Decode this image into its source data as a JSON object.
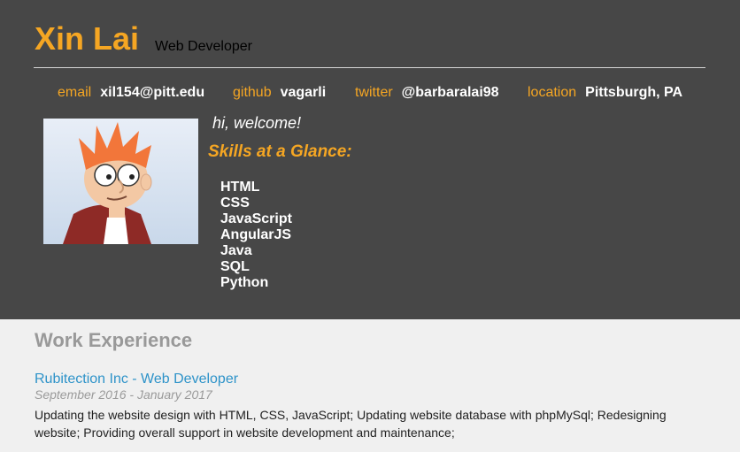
{
  "header": {
    "name": "Xin Lai",
    "role": "Web Developer"
  },
  "contacts": [
    {
      "label": "email",
      "value": "xil154@pitt.edu"
    },
    {
      "label": "github",
      "value": "vagarli"
    },
    {
      "label": "twitter",
      "value": "@barbaralai98"
    },
    {
      "label": "location",
      "value": "Pittsburgh, PA"
    }
  ],
  "profile": {
    "greeting": "hi, welcome!",
    "skills_heading": "Skills at a Glance:",
    "skills": [
      "HTML",
      "CSS",
      "JavaScript",
      "AngularJS",
      "Java",
      "SQL",
      "Python"
    ]
  },
  "work": {
    "heading": "Work Experience",
    "jobs": [
      {
        "title": "Rubitection Inc - Web Developer",
        "dates": "September 2016 - January 2017",
        "description": "Updating the website design with HTML, CSS, JavaScript; Updating website database with phpMySql; Redesigning website; Providing overall support in website development and maintenance;"
      }
    ]
  },
  "colors": {
    "accent": "#f5a623",
    "header_bg": "#474747",
    "body_bg": "#f0f0f0",
    "link": "#2e93c9"
  },
  "icons": {
    "avatar": "cartoon-character-avatar"
  }
}
